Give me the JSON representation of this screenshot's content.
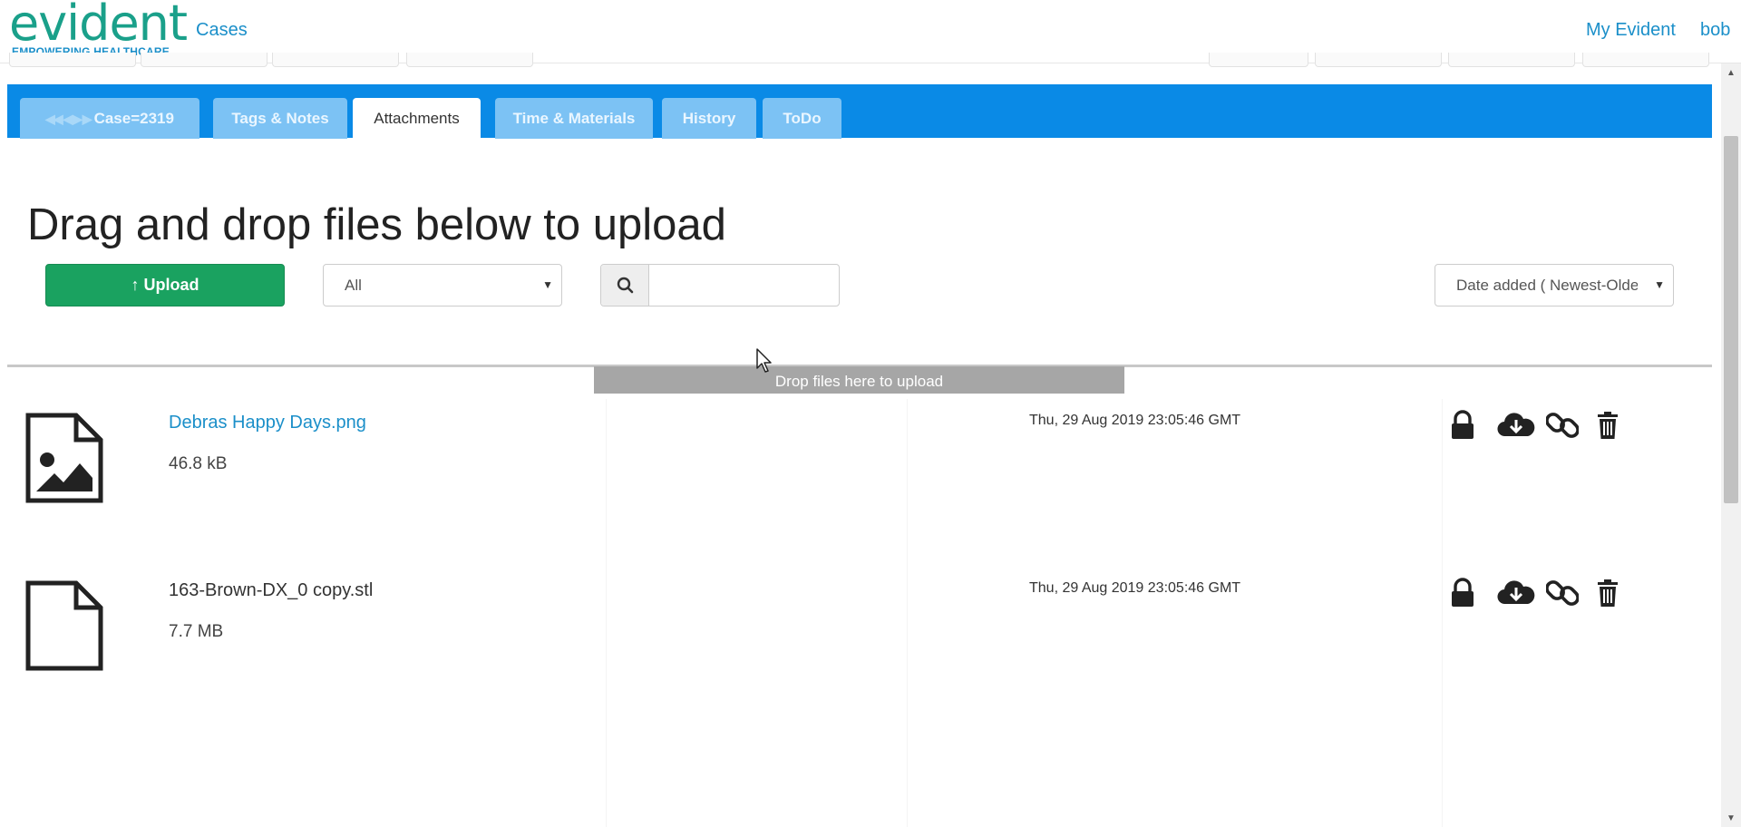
{
  "brand": {
    "logo_text": "evident",
    "tagline": "EMPOWERING HEALTHCARE",
    "logo_color": "#1aa08a",
    "tagline_color": "#1b8fc9"
  },
  "nav": {
    "cases": "Cases",
    "my_evident": "My Evident",
    "user": "bob",
    "link_color": "#1b8fc9"
  },
  "tabs": [
    {
      "label": "Case=2319",
      "active": false
    },
    {
      "label": "Tags & Notes",
      "active": false
    },
    {
      "label": "Attachments",
      "active": true
    },
    {
      "label": "Time & Materials",
      "active": false
    },
    {
      "label": "History",
      "active": false
    },
    {
      "label": "ToDo",
      "active": false
    }
  ],
  "page": {
    "heading": "Drag and drop files below to upload",
    "upload_button": "Upload",
    "filter_value": "All",
    "search_placeholder": "",
    "sort_value": "Date added ( Newest-Oldest )",
    "dropzone_label": "Drop files here to upload"
  },
  "attachments": [
    {
      "name": "Debras Happy Days.png",
      "size": "46.8 kB",
      "date": "Thu, 29 Aug 2019 23:05:46 GMT",
      "type_icon": "image-file-icon",
      "is_link": true
    },
    {
      "name": "163-Brown-DX_0 copy.stl",
      "size": "7.7 MB",
      "date": "Thu, 29 Aug 2019 23:05:46 GMT",
      "type_icon": "blank-file-icon",
      "is_link": false
    }
  ],
  "row_actions": [
    "lock-icon",
    "cloud-download-icon",
    "link-icon",
    "trash-icon"
  ],
  "colors": {
    "tab_bar": "#0a8ae6",
    "tab_inactive": "#7cc2f4",
    "upload_button": "#1aa260",
    "dropzone": "#a6a6a6"
  }
}
